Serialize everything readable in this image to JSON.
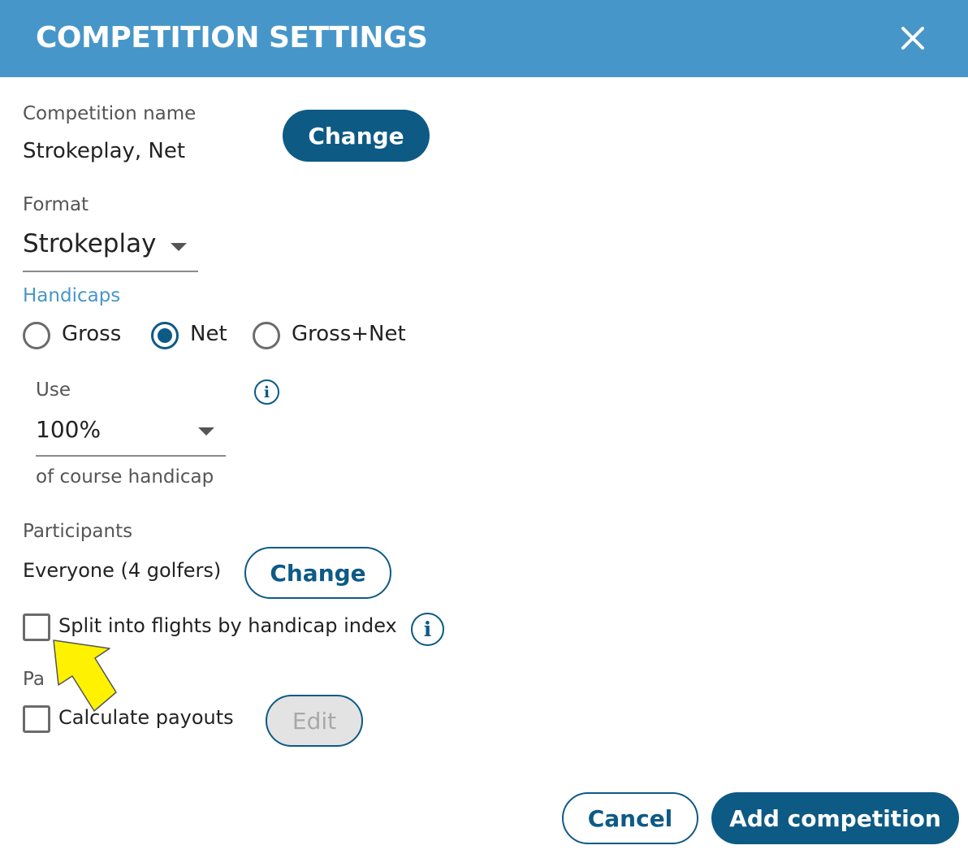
{
  "dialog": {
    "title": "COMPETITION SETTINGS",
    "close_icon": "close-icon"
  },
  "competition_name": {
    "label": "Competition name",
    "value": "Strokeplay, Net",
    "change_label": "Change"
  },
  "format": {
    "label": "Format",
    "selected": "Strokeplay"
  },
  "handicaps": {
    "label": "Handicaps",
    "options": [
      {
        "label": "Gross",
        "checked": false
      },
      {
        "label": "Net",
        "checked": true
      },
      {
        "label": "Gross+Net",
        "checked": false
      }
    ],
    "use_label": "Use",
    "use_selected": "100%",
    "use_suffix": "of course handicap",
    "info_icon": "info-icon"
  },
  "participants": {
    "label": "Participants",
    "value": "Everyone (4 golfers)",
    "change_label": "Change",
    "split_flights_label": "Split into flights by handicap index",
    "split_flights_checked": false
  },
  "payouts": {
    "label": "Pa",
    "calculate_label": "Calculate payouts",
    "calculate_checked": false,
    "edit_label": "Edit"
  },
  "footer": {
    "cancel_label": "Cancel",
    "submit_label": "Add competition"
  },
  "colors": {
    "header": "#4796c9",
    "primary": "#0d5a85",
    "handicaps_label": "#4796c9",
    "pointer_arrow": "#fff200"
  }
}
